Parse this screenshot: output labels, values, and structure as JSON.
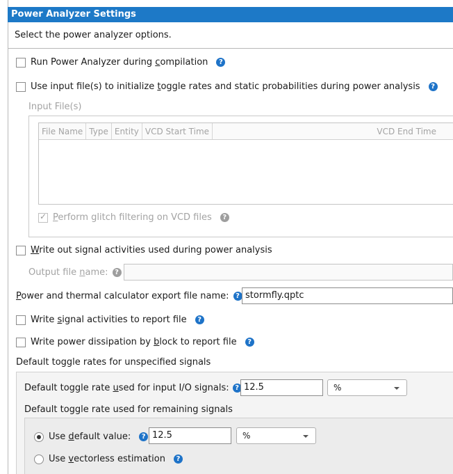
{
  "window": {
    "title": "Power Analyzer Settings",
    "description": "Select the power analyzer options."
  },
  "options": {
    "run_during_compilation": {
      "label_pre": "Run Power Analyzer during ",
      "label_ul": "c",
      "label_post": "ompilation",
      "checked": false
    },
    "use_input_files": {
      "label_pre": "Use input file(s) to initialize ",
      "label_ul": "t",
      "label_post": "oggle rates and static probabilities during power analysis",
      "checked": false
    },
    "input_files_group": "Input File(s)",
    "glitch_filtering": {
      "label_pre": "",
      "label_ul": "P",
      "label_post": "erform glitch filtering on VCD files",
      "checked": true
    },
    "write_signal_activities": {
      "label_pre": "",
      "label_ul": "W",
      "label_post": "rite out signal activities used during power analysis",
      "checked": false
    },
    "output_file": {
      "label_pre": "Output file ",
      "label_ul": "n",
      "label_post": "ame:",
      "value": ""
    },
    "export_file": {
      "label_pre": "",
      "label_ul": "P",
      "label_post": "ower and thermal calculator export file name:",
      "value": "stormfly.qptc"
    },
    "write_signal_report": {
      "label_pre": "Write ",
      "label_ul": "s",
      "label_post": "ignal activities to report file",
      "checked": false
    },
    "write_power_dissipation": {
      "label_pre": "Write power dissipation by ",
      "label_ul": "b",
      "label_post": "lock to report file",
      "checked": false
    }
  },
  "table": {
    "columns": [
      "File Name",
      "Type",
      "Entity",
      "VCD Start Time",
      "VCD End Time"
    ]
  },
  "toggle": {
    "group_label": "Default toggle rates for unspecified signals",
    "input_io": {
      "label_pre": "Default toggle rate ",
      "label_ul": "u",
      "label_post": "sed for input I/O signals:",
      "value": "12.5",
      "unit": "%"
    },
    "remaining_label": "Default toggle rate used for remaining signals",
    "use_default": {
      "label_pre": "Use ",
      "label_ul": "d",
      "label_post": "efault value:",
      "value": "12.5",
      "unit": "%",
      "selected": true
    },
    "vectorless": {
      "label_pre": "Use ",
      "label_ul": "v",
      "label_post": "ectorless estimation",
      "selected": false
    }
  },
  "icons": {
    "help": "?"
  },
  "colors": {
    "title_bar": "#1d79c7",
    "help_icon": "#1e73c8"
  }
}
